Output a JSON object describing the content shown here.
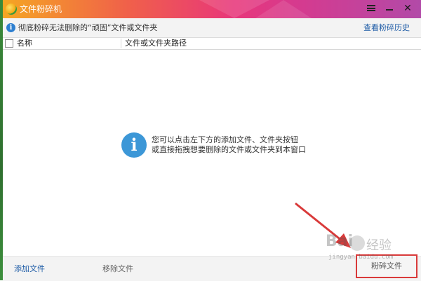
{
  "window": {
    "title": "文件粉碎机",
    "controls": {
      "menu": "menu-icon",
      "minimize": "minimize-icon",
      "close": "✕"
    }
  },
  "infobar": {
    "icon": "info-icon",
    "text": "彻底粉碎无法删除的“顽固”文件或文件夹",
    "history_link": "查看粉碎历史"
  },
  "table": {
    "columns": [
      "名称",
      "文件或文件夹路径"
    ]
  },
  "empty_state": {
    "icon": "info-icon",
    "line1": "您可以点击左下方的添加文件、文件夹按钮",
    "line2": "或直接拖拽想要删除的文件或文件夹到本窗口"
  },
  "footer": {
    "add_file": "添加文件",
    "remove_file": "移除文件",
    "shred_button": "粉碎文件"
  },
  "annotation": {
    "arrow_color": "#d93a3a",
    "highlight_color": "#d93a3a"
  },
  "watermark": {
    "logo": "Bai",
    "logo_cn": "经验",
    "url": "jingyan.baidu.com"
  },
  "colors": {
    "link_blue": "#1d5ba6",
    "info_blue": "#3c97d7"
  }
}
